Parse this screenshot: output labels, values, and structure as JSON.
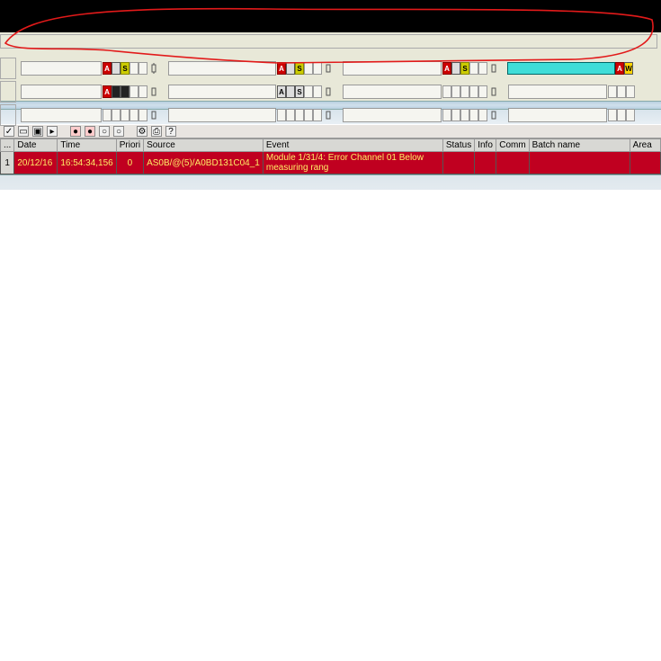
{
  "indicators": {
    "a": "A",
    "s": "S",
    "w": "W"
  },
  "toolbar": {
    "buttons": [
      "ack-icon",
      "filter-icon",
      "save-icon",
      "play-icon",
      "sep",
      "red1-icon",
      "red2-icon",
      "grey1-icon",
      "grey2-icon",
      "sep",
      "settings-icon",
      "print-icon",
      "help-icon"
    ]
  },
  "event_table": {
    "columns": [
      "...",
      "Date",
      "Time",
      "Priori",
      "Source",
      "Event",
      "Status",
      "Info",
      "Comm",
      "Batch name",
      "Area"
    ],
    "rows": [
      {
        "num": "1",
        "date": "20/12/16",
        "time": "16:54:34,156",
        "priority": "0",
        "source": "AS0B/@(5)/A0BD131C04_1",
        "event": "Module 1/31/4: Error Channel 01 Below measuring rang",
        "status": "",
        "info": "",
        "comm": "",
        "batch": "",
        "area": ""
      }
    ]
  }
}
